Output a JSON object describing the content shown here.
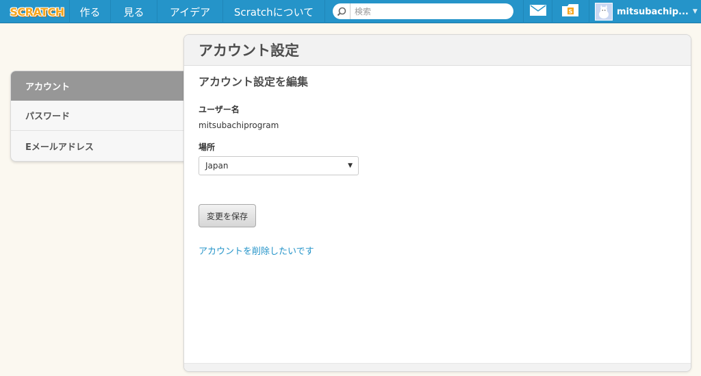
{
  "colors": {
    "topbar": "#2594c9",
    "background": "#fbf8f0",
    "active_sidebar": "#979797",
    "link": "#2594c9"
  },
  "topbar": {
    "logo": "SCRATCH",
    "nav": [
      "作る",
      "見る",
      "アイデア",
      "Scratchについて"
    ],
    "search_placeholder": "検索",
    "messages_icon": "envelope-icon",
    "mystuff_icon": "folder-icon",
    "username": "mitsubachip..."
  },
  "sidebar": {
    "items": [
      {
        "label": "アカウント",
        "active": true
      },
      {
        "label": "パスワード",
        "active": false
      },
      {
        "label": "Eメールアドレス",
        "active": false
      }
    ]
  },
  "panel": {
    "title": "アカウント設定",
    "section_title": "アカウント設定を編集",
    "username_label": "ユーザー名",
    "username_value": "mitsubachiprogram",
    "location_label": "場所",
    "location_value": "Japan",
    "save_label": "変更を保存",
    "delete_link": "アカウントを削除したいです"
  }
}
